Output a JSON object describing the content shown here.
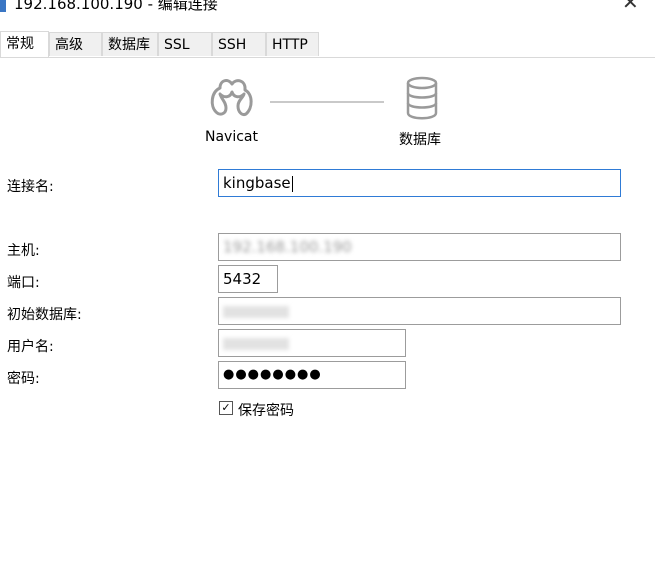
{
  "window": {
    "title": "192.168.100.190 - 编辑连接"
  },
  "tabs": [
    {
      "label": "常规",
      "active": true
    },
    {
      "label": "高级",
      "active": false
    },
    {
      "label": "数据库",
      "active": false
    },
    {
      "label": "SSL",
      "active": false
    },
    {
      "label": "SSH",
      "active": false
    },
    {
      "label": "HTTP",
      "active": false
    }
  ],
  "connection_graphic": {
    "left_label": "Navicat",
    "left_icon": "navicat-logo-icon",
    "right_label": "数据库",
    "right_icon": "database-icon"
  },
  "form": {
    "connection_name": {
      "label": "连接名:",
      "value": "kingbase"
    },
    "host": {
      "label": "主机:",
      "value": "192.168.100.190"
    },
    "port": {
      "label": "端口:",
      "value": "5432"
    },
    "initial_db": {
      "label": "初始数据库:",
      "value": ""
    },
    "username": {
      "label": "用户名:",
      "value": ""
    },
    "password": {
      "label": "密码:",
      "value": "●●●●●●●●"
    },
    "save_password": {
      "label": "保存密码",
      "checked": true
    }
  },
  "colors": {
    "focus_border": "#2f7bd6",
    "field_border": "#9c9c9c",
    "tab_bg": "#f0f0f0"
  }
}
